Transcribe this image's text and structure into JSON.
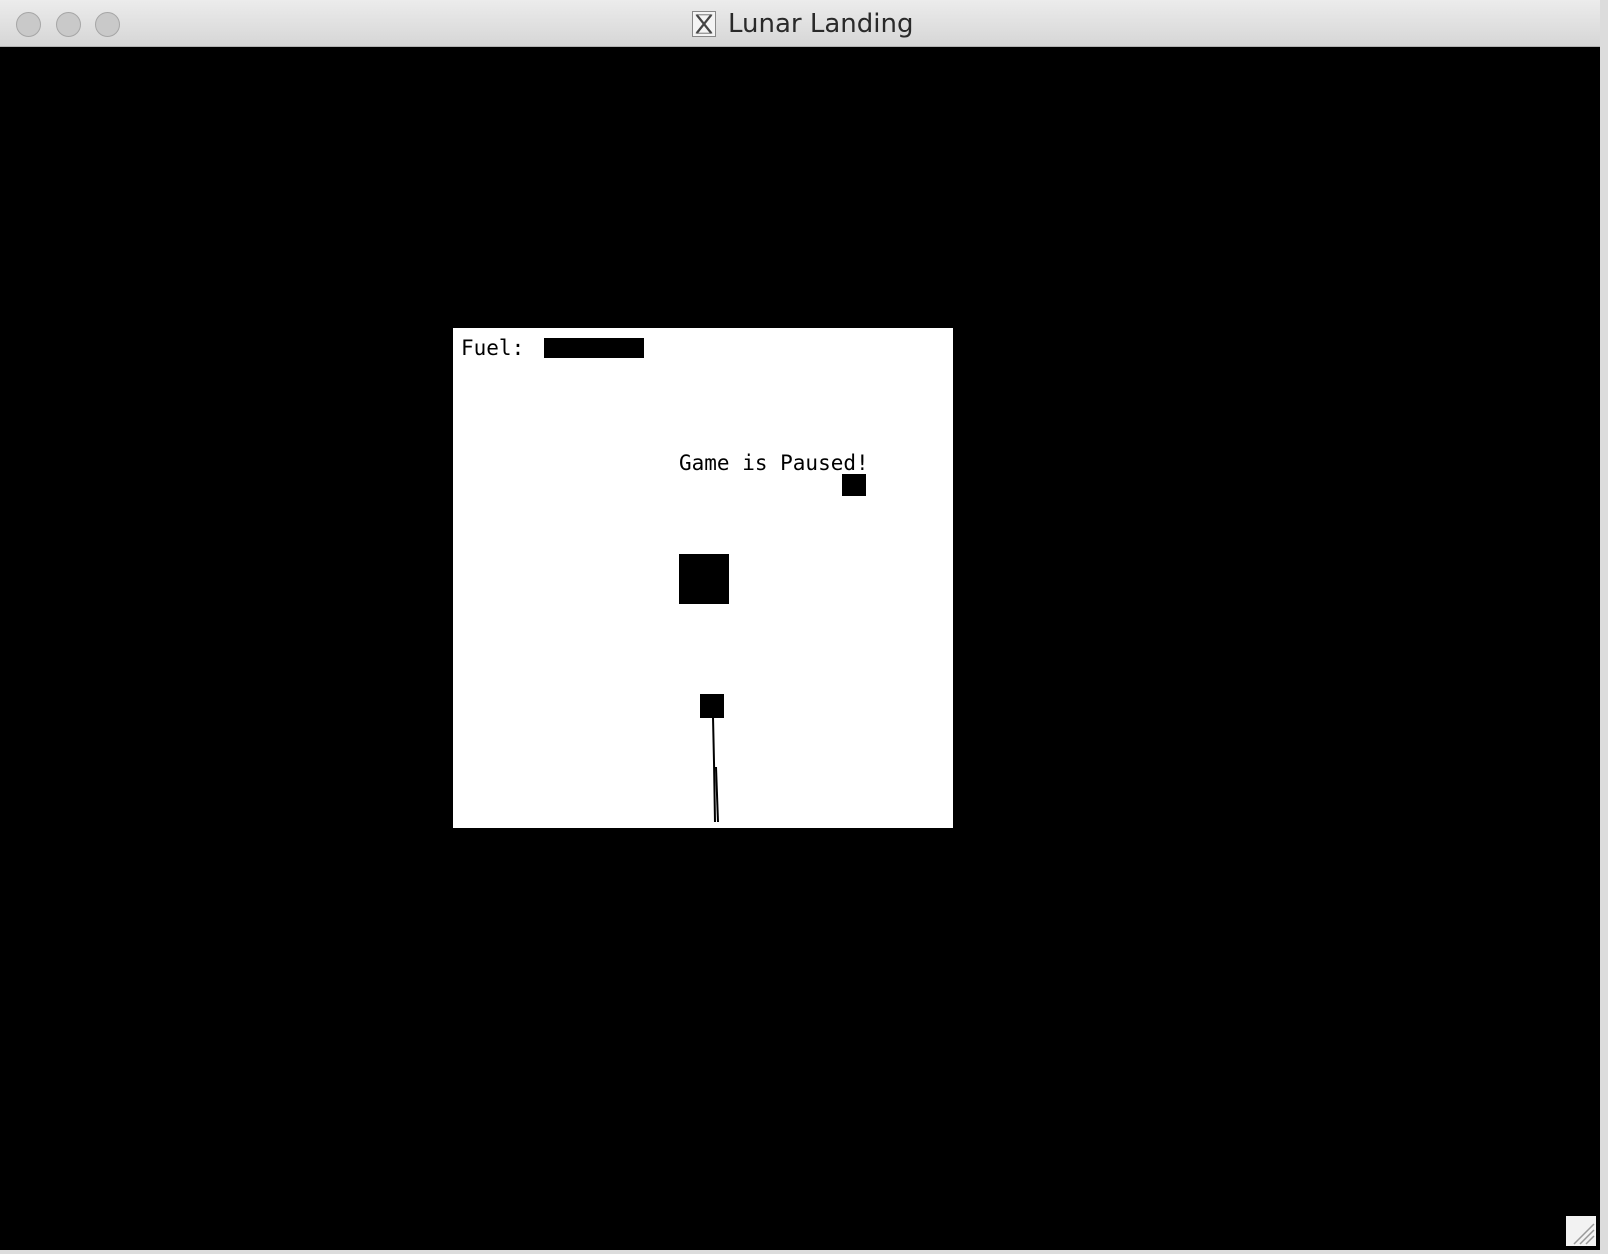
{
  "window": {
    "title": "Lunar Landing",
    "title_icon": "x11-icon"
  },
  "hud": {
    "fuel_label": "Fuel:",
    "fuel_level": 1.0
  },
  "status": {
    "pause_message": "Game is Paused!"
  },
  "colors": {
    "screen_background": "#000000",
    "playfield": "#ffffff",
    "sprites": "#000000"
  }
}
